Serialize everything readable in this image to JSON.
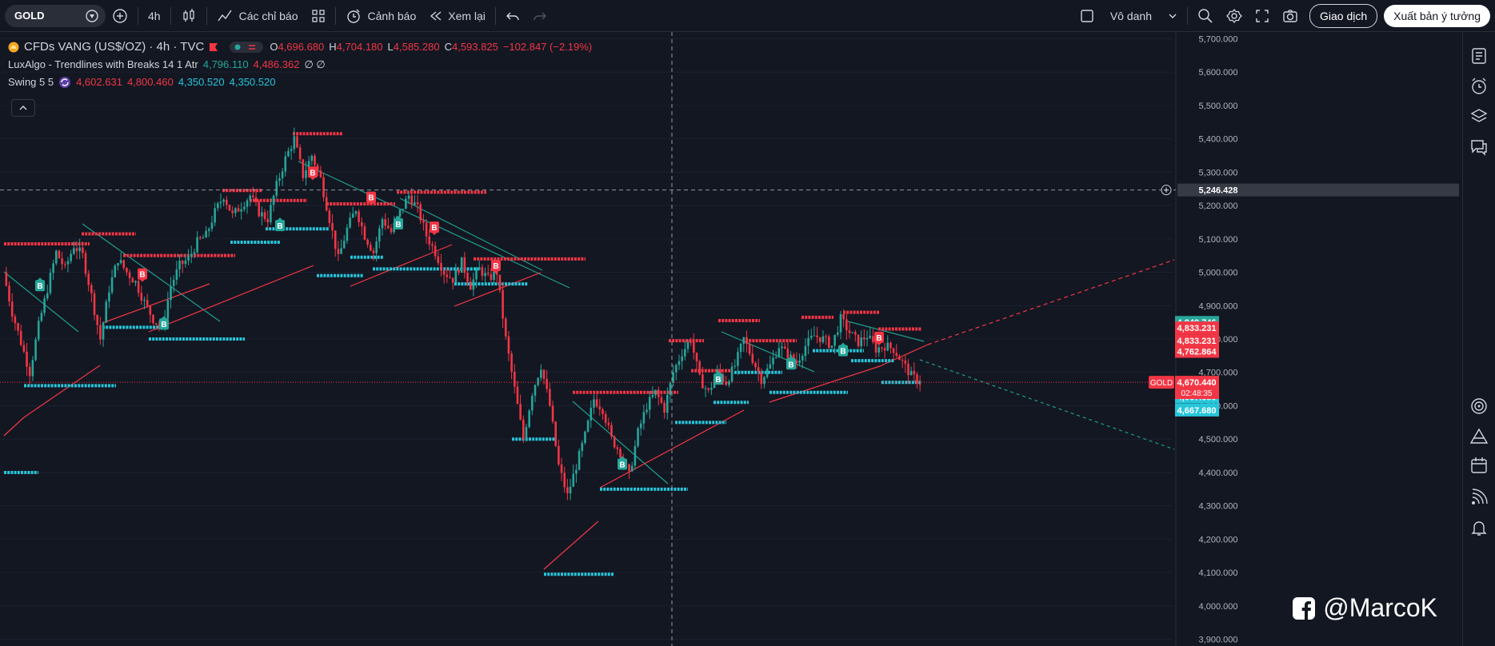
{
  "toolbar": {
    "symbol": "GOLD",
    "interval": "4h",
    "indicators_label": "Các chỉ báo",
    "alert_label": "Cảnh báo",
    "replay_label": "Xem lại",
    "layout_name": "Vô danh",
    "trade_label": "Giao dịch",
    "publish_label": "Xuất bản ý tưởng"
  },
  "legend": {
    "title": "CFDs VANG (US$/OZ) · 4h · TVC",
    "o_label": "O",
    "o_value": "4,696.680",
    "h_label": "H",
    "h_value": "4,704.180",
    "l_label": "L",
    "l_value": "4,585.280",
    "c_label": "C",
    "c_value": "4,593.825",
    "change": "−102.847 (−2.19%)",
    "ind1_name": "LuxAlgo - Trendlines with Breaks 14 1 Atr",
    "ind1_v1": "4,796.110",
    "ind1_v2": "4,486.362",
    "ind1_v3": "∅ ∅",
    "ind2_name": "Swing 5 5",
    "ind2_v1": "4,602.631",
    "ind2_v2": "4,800.460",
    "ind2_v3": "4,350.520",
    "ind2_v4": "4,350.520"
  },
  "watermark": "@MarcoK",
  "colors": {
    "bg": "#131722",
    "up": "#26a69a",
    "down": "#f23645",
    "support": "#26c6da",
    "resistance": "#f23645",
    "trend_down": "#1f9e8d",
    "trend_up": "#f23645",
    "text": "#d1d4dc"
  },
  "chart_data": {
    "type": "candlestick",
    "ylim": [
      3880,
      5720
    ],
    "y_ticks": [
      "5,700.000",
      "5,600.000",
      "5,500.000",
      "5,400.000",
      "5,300.000",
      "5,200.000",
      "5,100.000",
      "5,000.000",
      "4,900.000",
      "4,800.000",
      "4,700.000",
      "4,600.000",
      "4,500.000",
      "4,400.000",
      "4,300.000",
      "4,200.000",
      "4,100.000",
      "4,000.000",
      "3,900.000"
    ],
    "y_tick_values": [
      5700,
      5600,
      5500,
      5400,
      5300,
      5200,
      5100,
      5000,
      4900,
      4800,
      4700,
      4600,
      4500,
      4400,
      4300,
      4200,
      4100,
      4000,
      3900
    ],
    "close_path": [
      5000,
      4880,
      4790,
      4700,
      4840,
      4950,
      5060,
      5010,
      5080,
      5050,
      4930,
      4800,
      4950,
      5040,
      5000,
      4970,
      4910,
      4860,
      4830,
      4960,
      5020,
      5040,
      5090,
      5110,
      5180,
      5230,
      5170,
      5200,
      5230,
      5180,
      5160,
      5260,
      5340,
      5400,
      5290,
      5350,
      5280,
      5160,
      5040,
      5130,
      5190,
      5110,
      5060,
      5160,
      5120,
      5180,
      5230,
      5190,
      5110,
      5060,
      5000,
      4980,
      5030,
      4960,
      5010,
      4980,
      5000,
      4800,
      4650,
      4500,
      4640,
      4720,
      4600,
      4420,
      4330,
      4420,
      4510,
      4620,
      4590,
      4500,
      4460,
      4390,
      4520,
      4600,
      4640,
      4590,
      4700,
      4760,
      4800,
      4680,
      4640,
      4700,
      4670,
      4720,
      4800,
      4740,
      4680,
      4720,
      4780,
      4750,
      4730,
      4780,
      4810,
      4800,
      4780,
      4860,
      4820,
      4790,
      4810,
      4770,
      4780,
      4770,
      4730,
      4690,
      4670
    ],
    "support_lines": [
      {
        "x": [
          30,
          145
        ],
        "y": 4660
      },
      {
        "x": [
          5,
          48
        ],
        "y": 4400
      },
      {
        "x": [
          128,
          200
        ],
        "y": 4835
      },
      {
        "x": [
          186,
          306
        ],
        "y": 4800
      },
      {
        "x": [
          288,
          350
        ],
        "y": 5090
      },
      {
        "x": [
          332,
          412
        ],
        "y": 5130
      },
      {
        "x": [
          396,
          454
        ],
        "y": 4990
      },
      {
        "x": [
          438,
          480
        ],
        "y": 5045
      },
      {
        "x": [
          466,
          600
        ],
        "y": 5010
      },
      {
        "x": [
          568,
          660
        ],
        "y": 4965
      },
      {
        "x": [
          640,
          694
        ],
        "y": 4500
      },
      {
        "x": [
          680,
          768
        ],
        "y": 4095
      },
      {
        "x": [
          750,
          860
        ],
        "y": 4350
      },
      {
        "x": [
          844,
          908
        ],
        "y": 4550
      },
      {
        "x": [
          892,
          936
        ],
        "y": 4610
      },
      {
        "x": [
          918,
          978
        ],
        "y": 4700
      },
      {
        "x": [
          962,
          1060
        ],
        "y": 4640
      },
      {
        "x": [
          1016,
          1080
        ],
        "y": 4765
      },
      {
        "x": [
          1064,
          1118
        ],
        "y": 4735
      },
      {
        "x": [
          1102,
          1152
        ],
        "y": 4670
      }
    ],
    "resistance_lines": [
      {
        "x": [
          5,
          112
        ],
        "y": 5085
      },
      {
        "x": [
          102,
          170
        ],
        "y": 5115
      },
      {
        "x": [
          154,
          294
        ],
        "y": 5050
      },
      {
        "x": [
          278,
          328
        ],
        "y": 5245
      },
      {
        "x": [
          312,
          384
        ],
        "y": 5215
      },
      {
        "x": [
          366,
          428
        ],
        "y": 5415
      },
      {
        "x": [
          408,
          494
        ],
        "y": 5205
      },
      {
        "x": [
          496,
          608
        ],
        "y": 5240
      },
      {
        "x": [
          592,
          732
        ],
        "y": 5040
      },
      {
        "x": [
          716,
          848
        ],
        "y": 4640
      },
      {
        "x": [
          836,
          880
        ],
        "y": 4795
      },
      {
        "x": [
          864,
          916
        ],
        "y": 4705
      },
      {
        "x": [
          898,
          950
        ],
        "y": 4855
      },
      {
        "x": [
          932,
          996
        ],
        "y": 4795
      },
      {
        "x": [
          1002,
          1042
        ],
        "y": 4865
      },
      {
        "x": [
          1054,
          1100
        ],
        "y": 4880
      },
      {
        "x": [
          1098,
          1152
        ],
        "y": 4830
      }
    ],
    "breakout_labels": [
      {
        "x": 50,
        "y": 4960,
        "kind": "B",
        "dir": "up"
      },
      {
        "x": 178,
        "y": 4995,
        "kind": "B",
        "dir": "down"
      },
      {
        "x": 205,
        "y": 4845,
        "kind": "B",
        "dir": "up"
      },
      {
        "x": 350,
        "y": 5140,
        "kind": "B",
        "dir": "up"
      },
      {
        "x": 391,
        "y": 5300,
        "kind": "B",
        "dir": "down"
      },
      {
        "x": 464,
        "y": 5225,
        "kind": "B",
        "dir": "down"
      },
      {
        "x": 498,
        "y": 5145,
        "kind": "B",
        "dir": "up"
      },
      {
        "x": 543,
        "y": 5135,
        "kind": "B",
        "dir": "down"
      },
      {
        "x": 620,
        "y": 5020,
        "kind": "B",
        "dir": "down"
      },
      {
        "x": 778,
        "y": 4425,
        "kind": "B",
        "dir": "up"
      },
      {
        "x": 898,
        "y": 4680,
        "kind": "B",
        "dir": "up"
      },
      {
        "x": 989,
        "y": 4725,
        "kind": "B",
        "dir": "up"
      },
      {
        "x": 1054,
        "y": 4765,
        "kind": "B",
        "dir": "up"
      },
      {
        "x": 1099,
        "y": 4805,
        "kind": "B",
        "dir": "down"
      }
    ],
    "crosshair": {
      "x": 840,
      "price": "5,246.428",
      "value": 5246.428
    },
    "current_price": {
      "label": "GOLD",
      "price": "4,670.440",
      "countdown": "02:48:35",
      "value": 4670.44
    },
    "price_tags": [
      {
        "text": "4,849.746",
        "color": "#26a69a",
        "value": 4849.746
      },
      {
        "text": "4,833.231",
        "color": "#f23645",
        "value": 4833.231
      },
      {
        "text": "4,833.231",
        "color": "#f23645",
        "value": 4795
      },
      {
        "text": "4,762.864",
        "color": "#f23645",
        "value": 4762.864
      },
      {
        "text": "4,667.680",
        "color": "#26c6da",
        "value": 4626
      },
      {
        "text": "4,667.680",
        "color": "#26c6da",
        "value": 4587
      }
    ]
  }
}
